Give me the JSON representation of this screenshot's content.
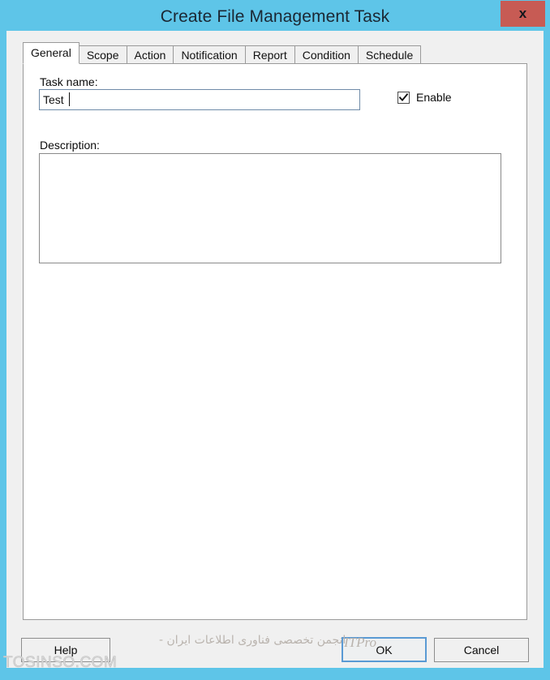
{
  "window": {
    "title": "Create File Management Task",
    "close_label": "x",
    "frame_color": "#5ec5e8",
    "close_button_color": "#c75b54",
    "body_color": "#f0f0f0"
  },
  "tabs": [
    {
      "label": "General",
      "active": true
    },
    {
      "label": "Scope",
      "active": false
    },
    {
      "label": "Action",
      "active": false
    },
    {
      "label": "Notification",
      "active": false
    },
    {
      "label": "Report",
      "active": false
    },
    {
      "label": "Condition",
      "active": false
    },
    {
      "label": "Schedule",
      "active": false
    }
  ],
  "general": {
    "task_name_label": "Task name:",
    "task_name_value": "Test ",
    "task_name_placeholder": "",
    "enable_label": "Enable",
    "enable_checked": true,
    "description_label": "Description:",
    "description_value": "",
    "description_placeholder": ""
  },
  "footer": {
    "help_label": "Help",
    "ok_label": "OK",
    "cancel_label": "Cancel",
    "focus_color": "#5a9ad4"
  },
  "watermarks": {
    "persian": "انجمن تخصصی فناوری اطلاعات ایران -",
    "itpro": "ITPro",
    "tosinso": "TOSINSO.COM"
  }
}
